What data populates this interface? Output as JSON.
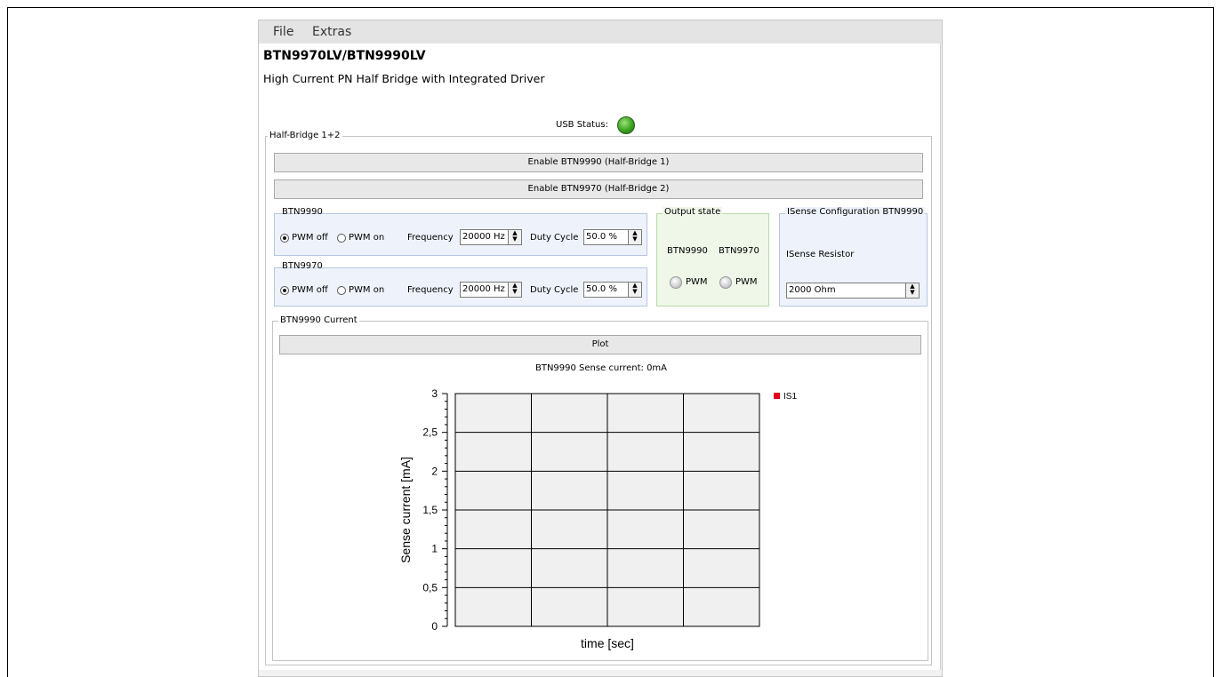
{
  "menu": {
    "file": "File",
    "extras": "Extras"
  },
  "header": {
    "title": "BTN9970LV/BTN9990LV",
    "subtitle": "High Current PN Half Bridge with Integrated Driver"
  },
  "usb": {
    "label": "USB Status:",
    "state_color": "#3aa21d"
  },
  "half_bridge_group": {
    "title": "Half-Bridge 1+2",
    "enable_9990": "Enable BTN9990 (Half-Bridge 1)",
    "enable_9970": "Enable BTN9970 (Half-Bridge 2)"
  },
  "btn9990": {
    "title": "BTN9990",
    "pwm_off": "PWM off",
    "pwm_on": "PWM on",
    "selected": "PWM off",
    "frequency_label": "Frequency",
    "frequency_value": "20000 Hz",
    "duty_label": "Duty Cycle",
    "duty_value": "50.0 %"
  },
  "btn9970": {
    "title": "BTN9970",
    "pwm_off": "PWM off",
    "pwm_on": "PWM on",
    "selected": "PWM off",
    "frequency_label": "Frequency",
    "frequency_value": "20000 Hz",
    "duty_label": "Duty Cycle",
    "duty_value": "50.0 %"
  },
  "output_state": {
    "title": "Output state",
    "col1": "BTN9990",
    "col2": "BTN9970",
    "led1_label": "PWM",
    "led2_label": "PWM"
  },
  "isense": {
    "title": "ISense Configuration BTN9990",
    "resistor_label": "ISense Resistor",
    "resistor_value": "2000 Ohm"
  },
  "current_group": {
    "title": "BTN9990 Current",
    "plot_button": "Plot",
    "sense_text": "BTN9990 Sense current:  0mA"
  },
  "chart_data": {
    "type": "line",
    "title": "",
    "xlabel": "time [sec]",
    "ylabel": "Sense current [mA]",
    "ylim": [
      0,
      3
    ],
    "y_ticks": [
      "0",
      "0,5",
      "1",
      "1,5",
      "2",
      "2,5",
      "3"
    ],
    "x_ticks": [],
    "grid": true,
    "legend_position": "top-right",
    "series": [
      {
        "name": "IS1",
        "color": "#e3001b",
        "values": []
      }
    ]
  }
}
